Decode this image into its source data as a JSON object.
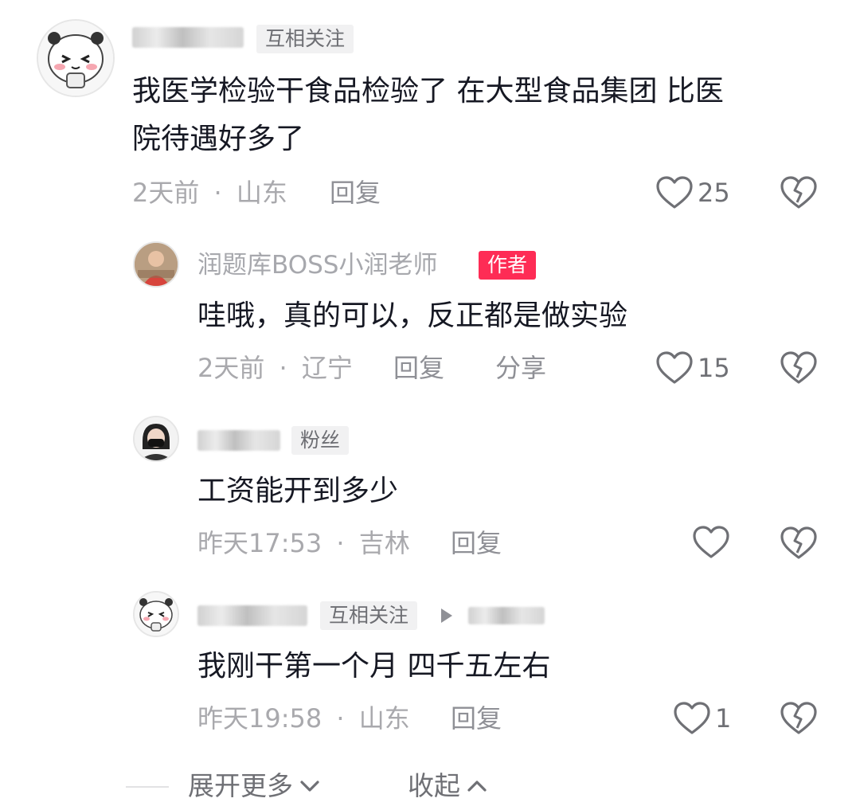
{
  "comments": [
    {
      "tag": "互相关注",
      "text_lines": [
        "我医学检验干食品检验了 在大型食品集团 比医",
        "院待遇好多了"
      ],
      "time": "2天前",
      "location": "山东",
      "reply_label": "回复",
      "like_count": "25",
      "icons": [
        "heart-outline-icon",
        "broken-heart-icon"
      ]
    },
    {
      "username": "润题库BOSS小润老师",
      "tag": "作者",
      "text": "哇哦，真的可以，反正都是做实验",
      "time": "2天前",
      "location": "辽宁",
      "reply_label": "回复",
      "share_label": "分享",
      "like_count": "15"
    },
    {
      "tag": "粉丝",
      "text": "工资能开到多少",
      "time": "昨天17:53",
      "location": "吉林",
      "reply_label": "回复",
      "like_count": ""
    },
    {
      "tag": "互相关注",
      "text": "我刚干第一个月 四千五左右",
      "time": "昨天19:58",
      "location": "山东",
      "reply_label": "回复",
      "like_count": "1"
    }
  ],
  "separator": "·",
  "footer": {
    "expand_label": "展开更多",
    "collapse_label": "收起"
  },
  "colors": {
    "author_tag": "#fe2c55",
    "meta_text": "#a9a9ad",
    "body_text": "#161823"
  }
}
